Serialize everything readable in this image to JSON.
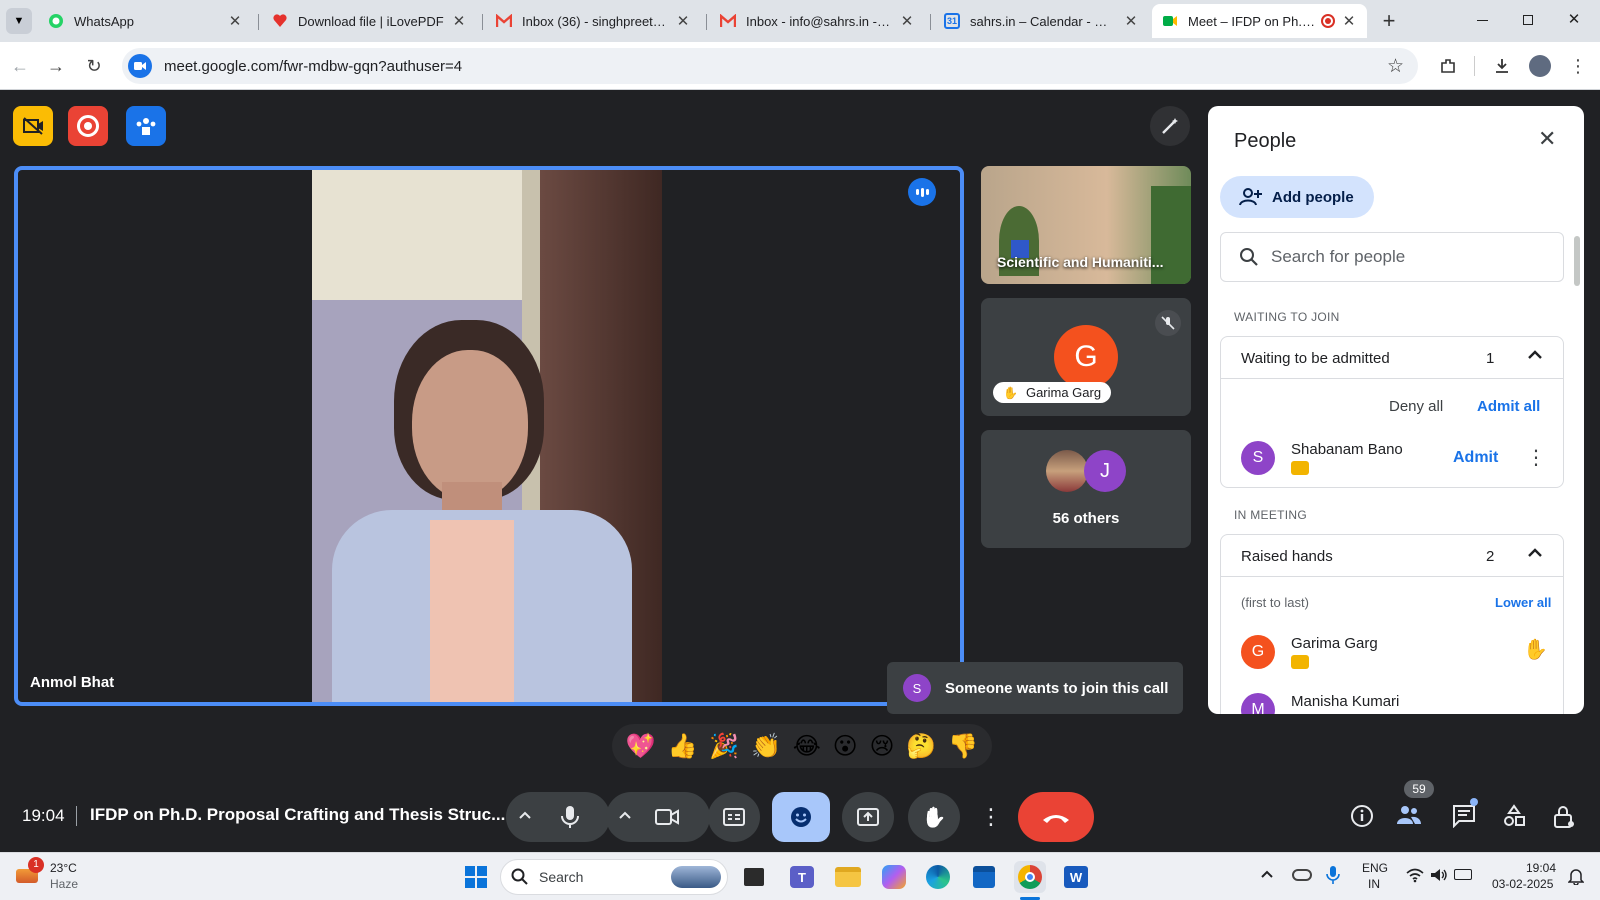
{
  "browser": {
    "tabs": [
      {
        "title": "WhatsApp",
        "icon": "whatsapp-icon"
      },
      {
        "title": "Download file | iLovePDF",
        "icon": "ilovepdf-icon"
      },
      {
        "title": "Inbox (36) - singhpreetam",
        "icon": "gmail-icon"
      },
      {
        "title": "Inbox - info@sahrs.in - sah",
        "icon": "gmail-icon"
      },
      {
        "title": "sahrs.in – Calendar - Mond",
        "icon": "calendar-icon"
      },
      {
        "title": "Meet – IFDP on Ph.D. P",
        "icon": "meet-icon"
      }
    ],
    "url": "meet.google.com/fwr-mdbw-gqn?authuser=4"
  },
  "meet": {
    "main_speaker": "Anmol Bhat",
    "tiles": {
      "tile1_name": "Scientific and Humaniti...",
      "tile2_initial": "G",
      "tile2_name": "Garima Garg",
      "tile3_initial": "J",
      "tile3_label": "56 others"
    },
    "toast": {
      "initial": "S",
      "text": "Someone wants to join this call"
    },
    "reactions": [
      "💖",
      "👍",
      "🎉",
      "👏",
      "😂",
      "😮",
      "😢",
      "🤔",
      "👎"
    ],
    "bottom": {
      "time": "19:04",
      "title": "IFDP on Ph.D. Proposal Crafting and Thesis Struc...",
      "participants_count": "59"
    }
  },
  "people_panel": {
    "title": "People",
    "add_people": "Add people",
    "search_placeholder": "Search for people",
    "waiting_section": "WAITING TO JOIN",
    "waiting_header": "Waiting to be admitted",
    "waiting_count": "1",
    "deny_all": "Deny all",
    "admit_all": "Admit all",
    "waiting_person": {
      "initial": "S",
      "name": "Shabanam Bano",
      "action": "Admit"
    },
    "in_meeting_section": "IN MEETING",
    "raised_header": "Raised hands",
    "raised_count": "2",
    "raised_order": "(first to last)",
    "lower_all": "Lower all",
    "raised_people": [
      {
        "initial": "G",
        "name": "Garima Garg"
      },
      {
        "initial": "M",
        "name": "Manisha Kumari"
      }
    ]
  },
  "taskbar": {
    "weather_temp": "23°C",
    "weather_desc": "Haze",
    "weather_badge": "1",
    "search": "Search",
    "lang1": "ENG",
    "lang2": "IN",
    "time": "19:04",
    "date": "03-02-2025"
  },
  "colors": {
    "accent": "#1a73e8",
    "end_call": "#ea4335",
    "meet_bg": "#202124",
    "tile": "#3c4043",
    "garima": "#f4511e",
    "purple": "#8e44c8"
  }
}
